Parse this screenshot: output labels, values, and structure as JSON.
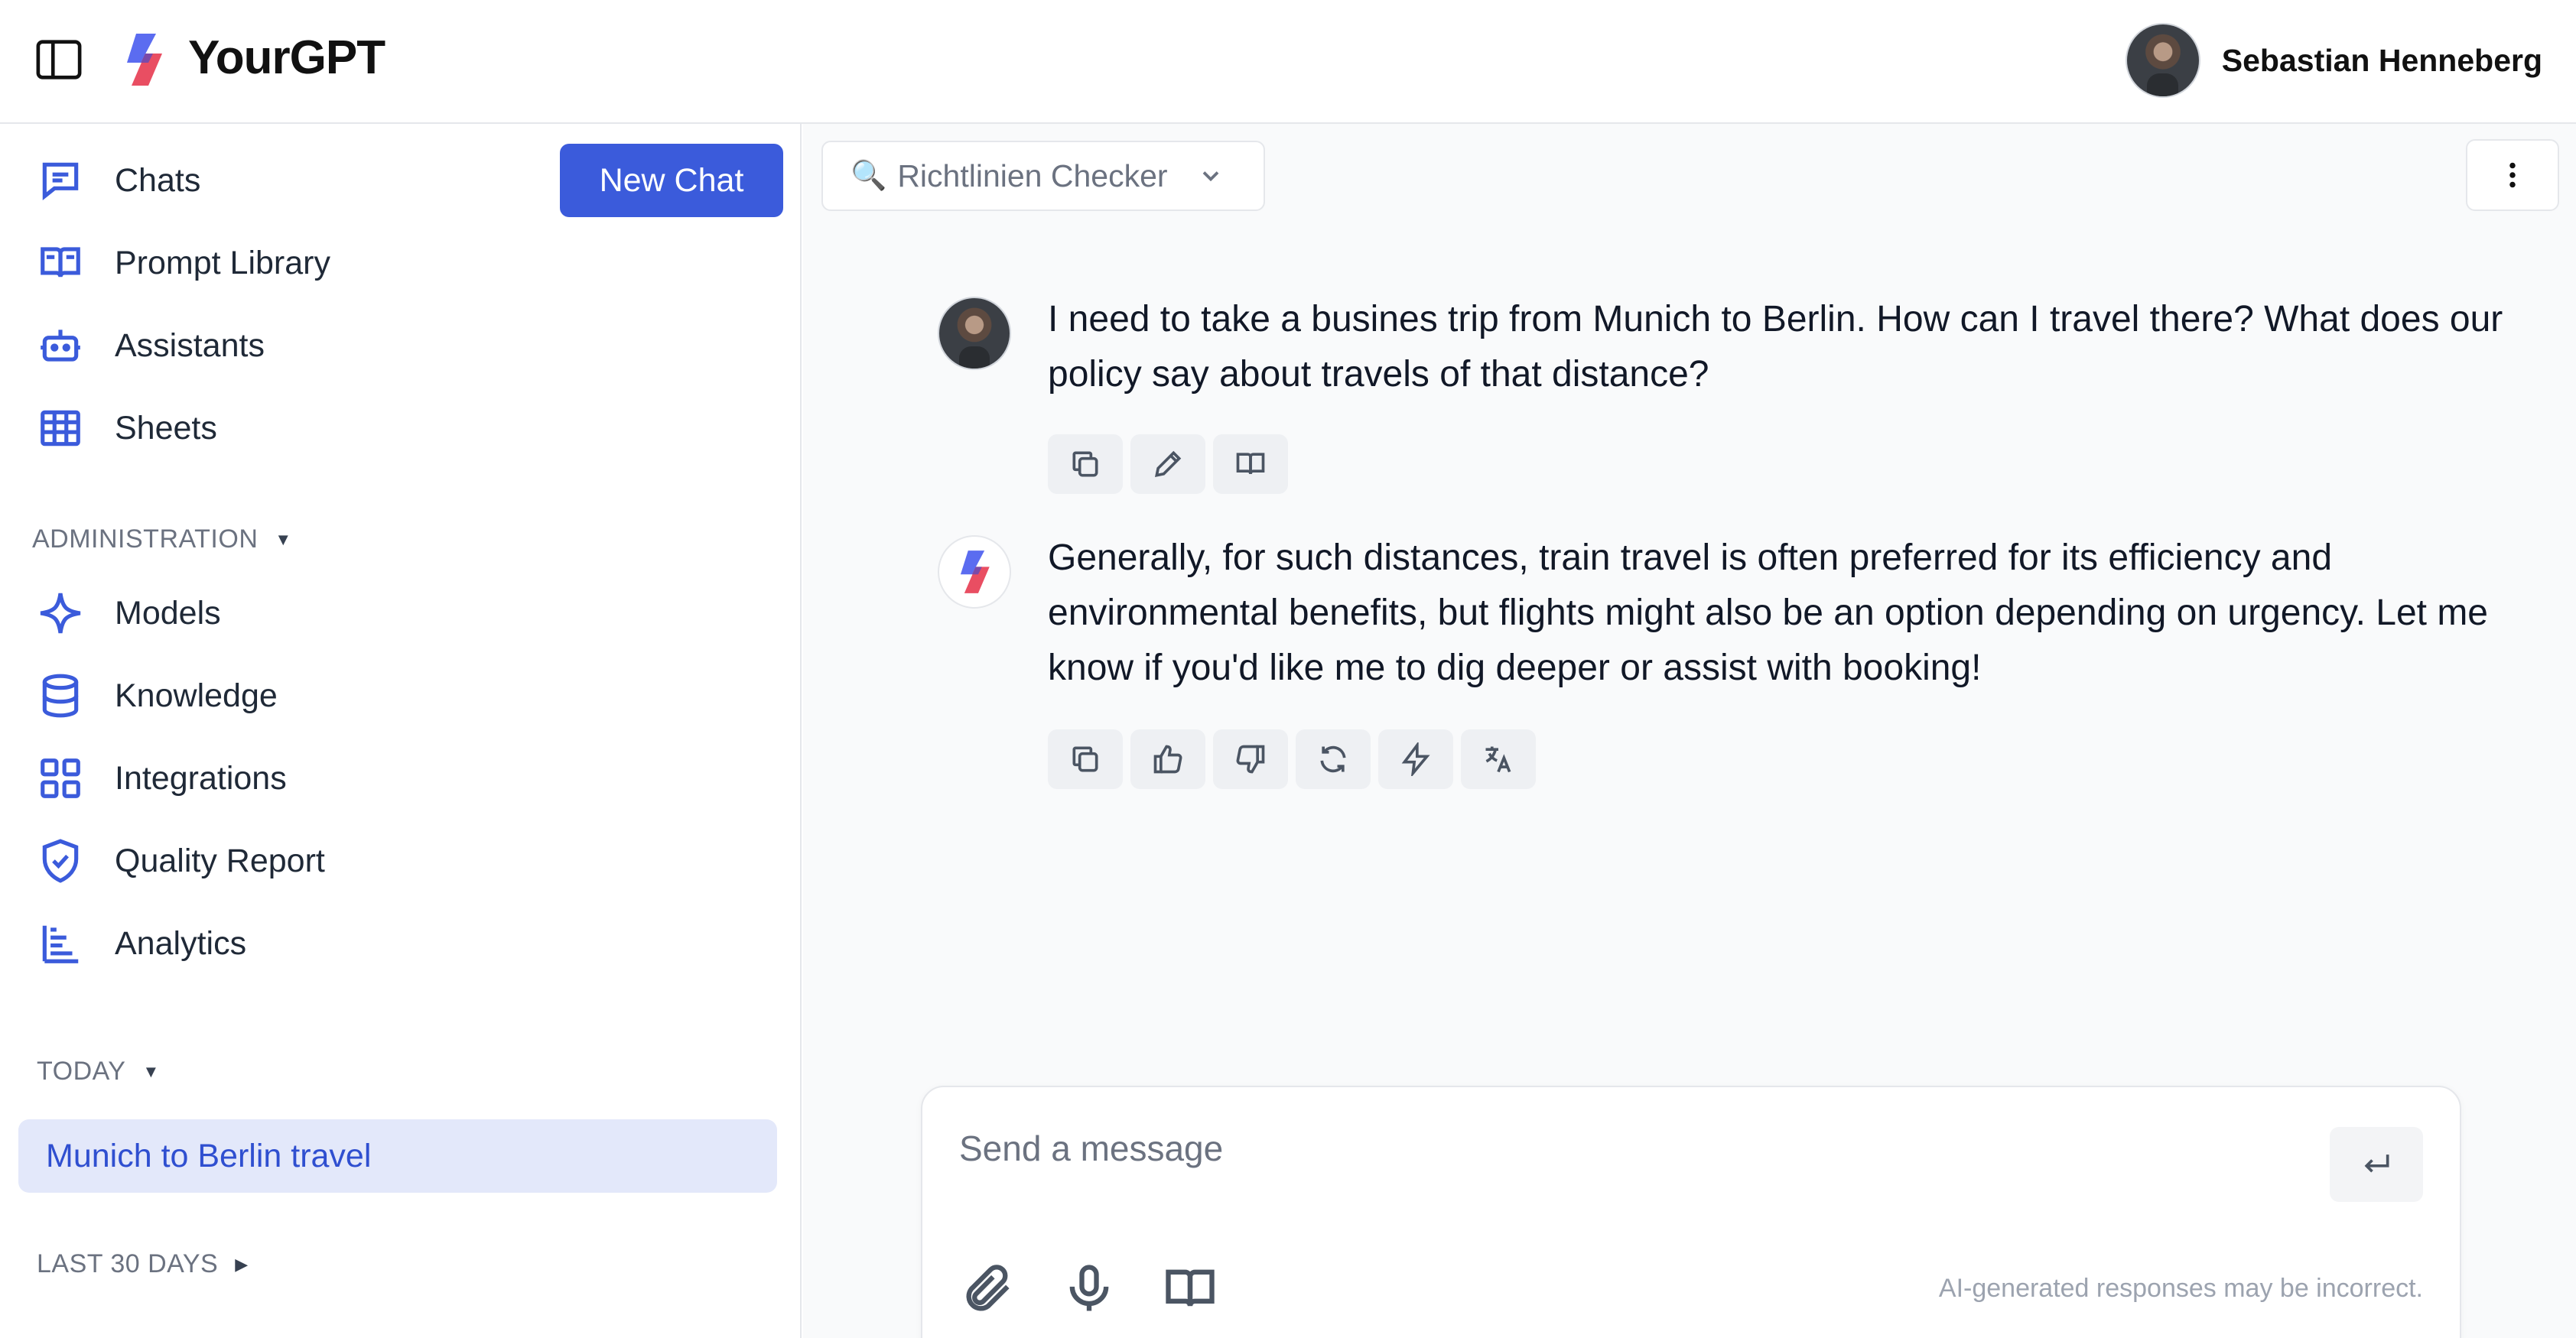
{
  "app": {
    "title": "YourGPT"
  },
  "user": {
    "name": "Sebastian Henneberg"
  },
  "sidebar": {
    "new_chat_label": "New Chat",
    "items": [
      {
        "label": "Chats",
        "icon": "chat-icon"
      },
      {
        "label": "Prompt Library",
        "icon": "book-icon"
      },
      {
        "label": "Assistants",
        "icon": "robot-icon"
      },
      {
        "label": "Sheets",
        "icon": "table-icon"
      }
    ],
    "admin_heading": "ADMINISTRATION",
    "admin_items": [
      {
        "label": "Models",
        "icon": "sparkle-icon"
      },
      {
        "label": "Knowledge",
        "icon": "database-icon"
      },
      {
        "label": "Integrations",
        "icon": "grid-icon"
      },
      {
        "label": "Quality Report",
        "icon": "shield-check-icon"
      },
      {
        "label": "Analytics",
        "icon": "bar-chart-icon"
      }
    ],
    "today_heading": "TODAY",
    "today_chats": [
      "Munich to Berlin travel"
    ],
    "last30_heading": "LAST 30 DAYS"
  },
  "main": {
    "assistant": {
      "emoji": "🔍",
      "label": "Richtlinien Checker"
    },
    "messages": [
      {
        "role": "user",
        "text": "I need to take a busines trip from Munich to Berlin. How can I travel there? What does our policy say about travels of that distance?"
      },
      {
        "role": "assistant",
        "text": "Generally, for such distances, train travel is often preferred for its efficiency and environmental benefits, but flights might also be an option depending on urgency. Let me know if you'd like me to dig deeper or assist with booking!"
      }
    ],
    "composer": {
      "placeholder": "Send a message",
      "disclaimer": "AI-generated responses may be incorrect."
    }
  },
  "colors": {
    "accent": "#3b5bdb",
    "selected_bg": "#e3e8fa",
    "logo_blue": "#5b6cf0",
    "logo_red": "#e8455a"
  }
}
